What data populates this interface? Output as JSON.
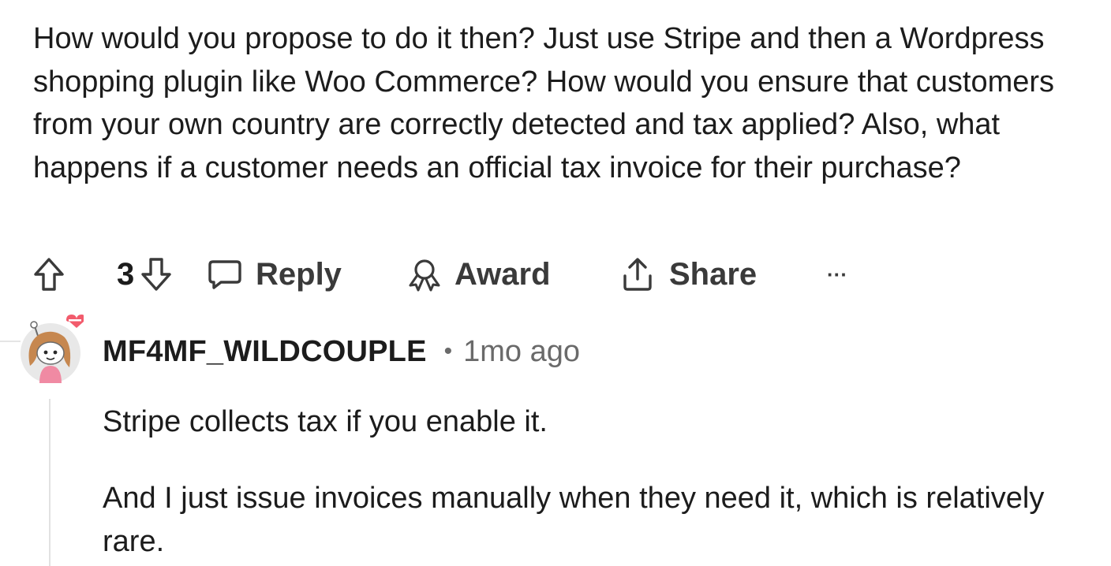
{
  "comment": {
    "body": "How would you propose to do it then? Just use Stripe and then a Wordpress shopping plugin like Woo Commerce? How would you ensure that customers from your own country are correctly detected and tax applied? Also, what happens if a customer needs an official tax invoice for their purchase?",
    "vote_count": "3",
    "actions": {
      "reply_label": "Reply",
      "award_label": "Award",
      "share_label": "Share",
      "more_label": "···"
    }
  },
  "reply": {
    "username": "MF4MF_WILDCOUPLE",
    "separator": "•",
    "timestamp": "1mo ago",
    "paragraphs": [
      "Stripe collects tax if you enable it.",
      "And I just issue invoices manually when they need it, which is relatively rare."
    ]
  },
  "icons": {
    "upvote": "upvote-arrow-icon",
    "downvote": "downvote-arrow-icon",
    "reply": "speech-bubble-icon",
    "award": "award-ribbon-icon",
    "share": "share-upload-icon",
    "more": "ellipsis-icon",
    "avatar": "snoo-avatar"
  },
  "colors": {
    "text": "#1c1c1c",
    "meta": "#6a6a6a",
    "action": "#3a3a3a",
    "thread_line": "#e2e2e2"
  }
}
